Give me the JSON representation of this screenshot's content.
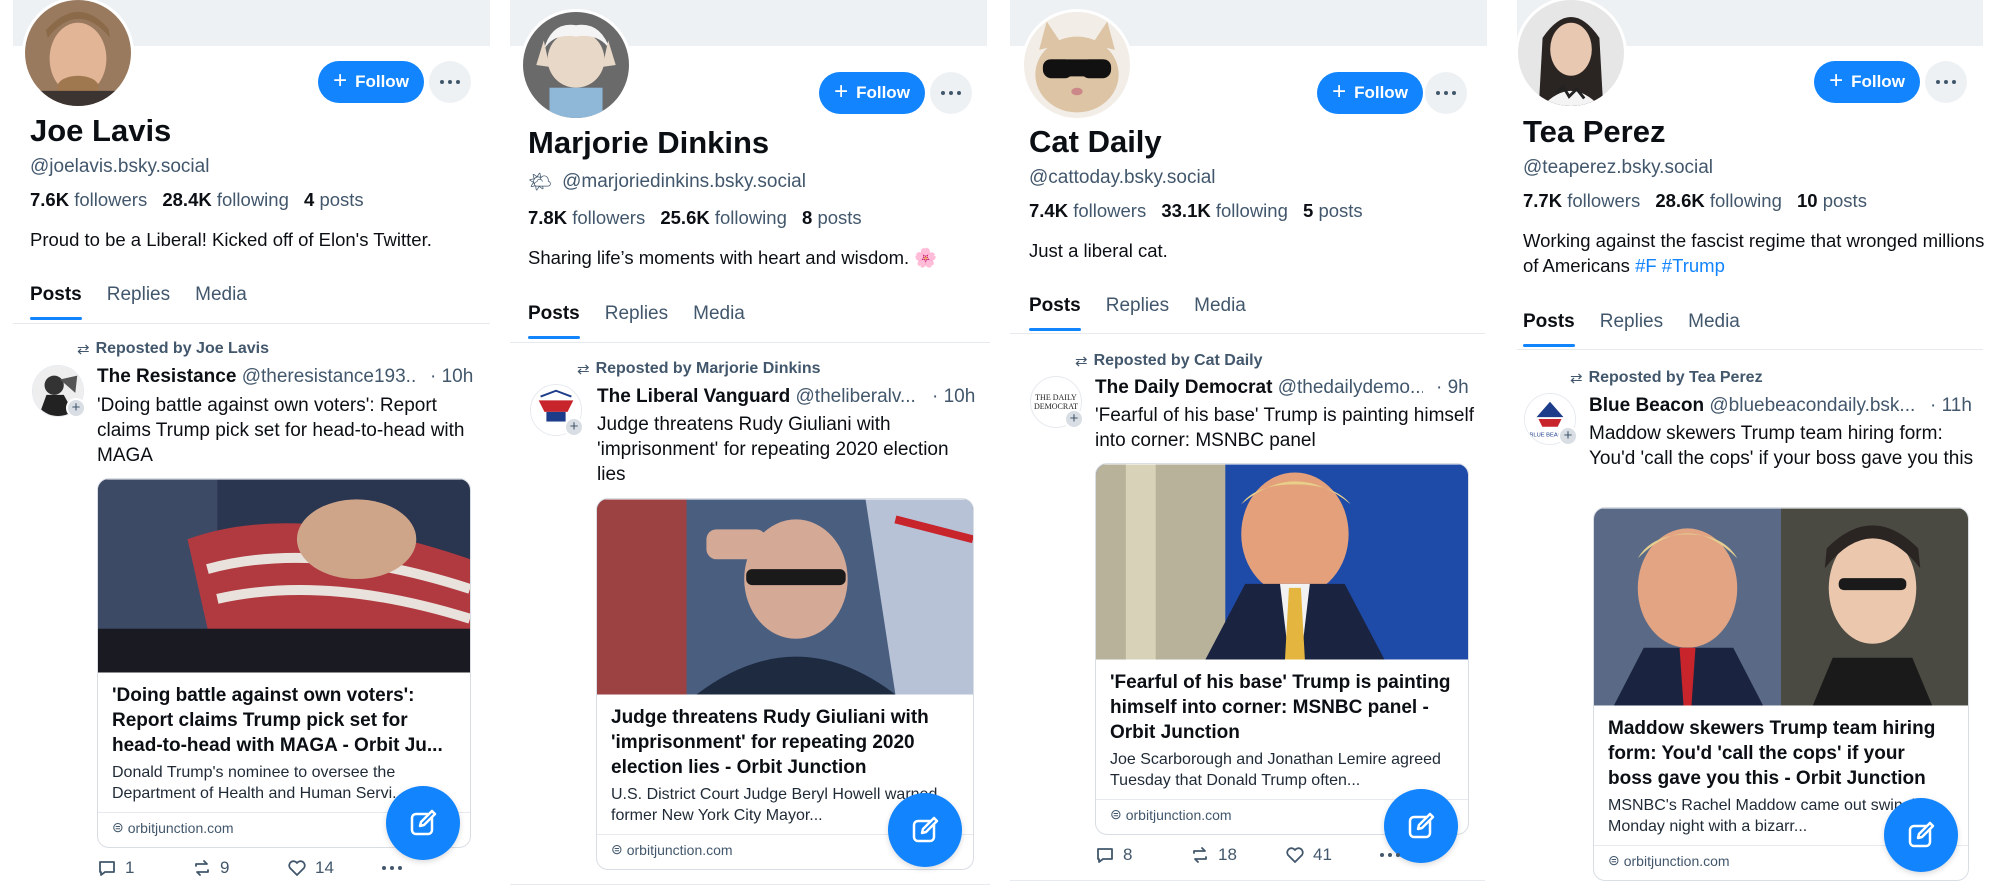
{
  "colors": {
    "accent": "#1184fe",
    "muted": "#42576c",
    "text": "#0b0f14"
  },
  "common": {
    "follow_label": "Follow",
    "repost_prefix": "Reposted by"
  },
  "panels": [
    {
      "name": "Joe Lavis",
      "handle": "@joelavis.bsky.social",
      "handle_emoji": "",
      "followers": "7.6K",
      "followers_label": "followers",
      "following": "28.4K",
      "following_label": "following",
      "posts": "4",
      "posts_label": "posts",
      "bio": "Proud to be a Liberal! Kicked off of Elon's Twitter.",
      "bio_tags": "",
      "tabs": [
        "Posts",
        "Replies",
        "Media"
      ],
      "repost_line": "Reposted by Joe Lavis",
      "post": {
        "author": "The Resistance",
        "handle": "@theresistance193...",
        "time": "· 10h",
        "text": "'Doing battle against own voters': Report claims Trump pick set for head-to-head with MAGA",
        "card_title": "'Doing battle against own voters': Report claims Trump pick set for head-to-head with MAGA - Orbit Ju...",
        "card_desc": "Donald Trump's nominee to oversee the Department of Health and Human Servi...",
        "card_domain": "orbitjunction.com",
        "replies": "1",
        "reposts": "9",
        "likes": "14"
      }
    },
    {
      "name": "Marjorie Dinkins",
      "handle": "@marjoriedinkins.bsky.social",
      "handle_emoji": "🌤",
      "followers": "7.8K",
      "followers_label": "followers",
      "following": "25.6K",
      "following_label": "following",
      "posts": "8",
      "posts_label": "posts",
      "bio": "Sharing life’s moments with heart and wisdom. 🌸",
      "bio_tags": "",
      "tabs": [
        "Posts",
        "Replies",
        "Media"
      ],
      "repost_line": "Reposted by Marjorie Dinkins",
      "post": {
        "author": "The Liberal Vanguard",
        "handle": "@theliberalv...",
        "time": "· 10h",
        "text": "Judge threatens Rudy Giuliani with 'imprisonment' for repeating 2020 election lies",
        "card_title": "Judge threatens Rudy Giuliani with 'imprisonment' for repeating 2020 election lies - Orbit Junction",
        "card_desc": "U.S. District Court Judge Beryl Howell warned former New York City Mayor...",
        "card_domain": "orbitjunction.com"
      }
    },
    {
      "name": "Cat Daily",
      "handle": "@cattoday.bsky.social",
      "handle_emoji": "",
      "followers": "7.4K",
      "followers_label": "followers",
      "following": "33.1K",
      "following_label": "following",
      "posts": "5",
      "posts_label": "posts",
      "bio": "Just a liberal cat.",
      "bio_tags": "",
      "tabs": [
        "Posts",
        "Replies",
        "Media"
      ],
      "repost_line": "Reposted by Cat Daily",
      "post": {
        "author": "The Daily Democrat",
        "handle": "@thedailydemo...",
        "time": "· 9h",
        "text": "'Fearful of his base' Trump is painting himself into corner: MSNBC panel",
        "avatar_text": "THE DAILY DEMOCRAT",
        "card_title": "'Fearful of his base' Trump is painting himself into corner: MSNBC panel - Orbit Junction",
        "card_desc": "Joe Scarborough and Jonathan Lemire agreed Tuesday that Donald Trump often...",
        "card_domain": "orbitjunction.com",
        "replies": "8",
        "reposts": "18",
        "likes": "41"
      }
    },
    {
      "name": "Tea Perez",
      "handle": "@teaperez.bsky.social",
      "handle_emoji": "",
      "followers": "7.7K",
      "followers_label": "followers",
      "following": "28.6K",
      "following_label": "following",
      "posts": "10",
      "posts_label": "posts",
      "bio": "Working against the fascist regime that wronged millions of Americans",
      "bio_tags": "#F #Trump",
      "tabs": [
        "Posts",
        "Replies",
        "Media"
      ],
      "repost_line": "Reposted by Tea Perez",
      "post": {
        "author": "Blue Beacon",
        "handle": "@bluebeacondaily.bsk...",
        "time": "· 11h",
        "text": "Maddow skewers Trump team hiring form: You'd 'call the cops' if your boss gave you this",
        "avatar_text": "BLUE BEACON",
        "card_title": "Maddow skewers Trump team hiring form: You'd 'call the cops' if your boss gave you this - Orbit Junction",
        "card_desc": "MSNBC's Rachel Maddow came out swinging Monday night with a bizarr...",
        "card_domain": "orbitjunction.com"
      }
    }
  ]
}
